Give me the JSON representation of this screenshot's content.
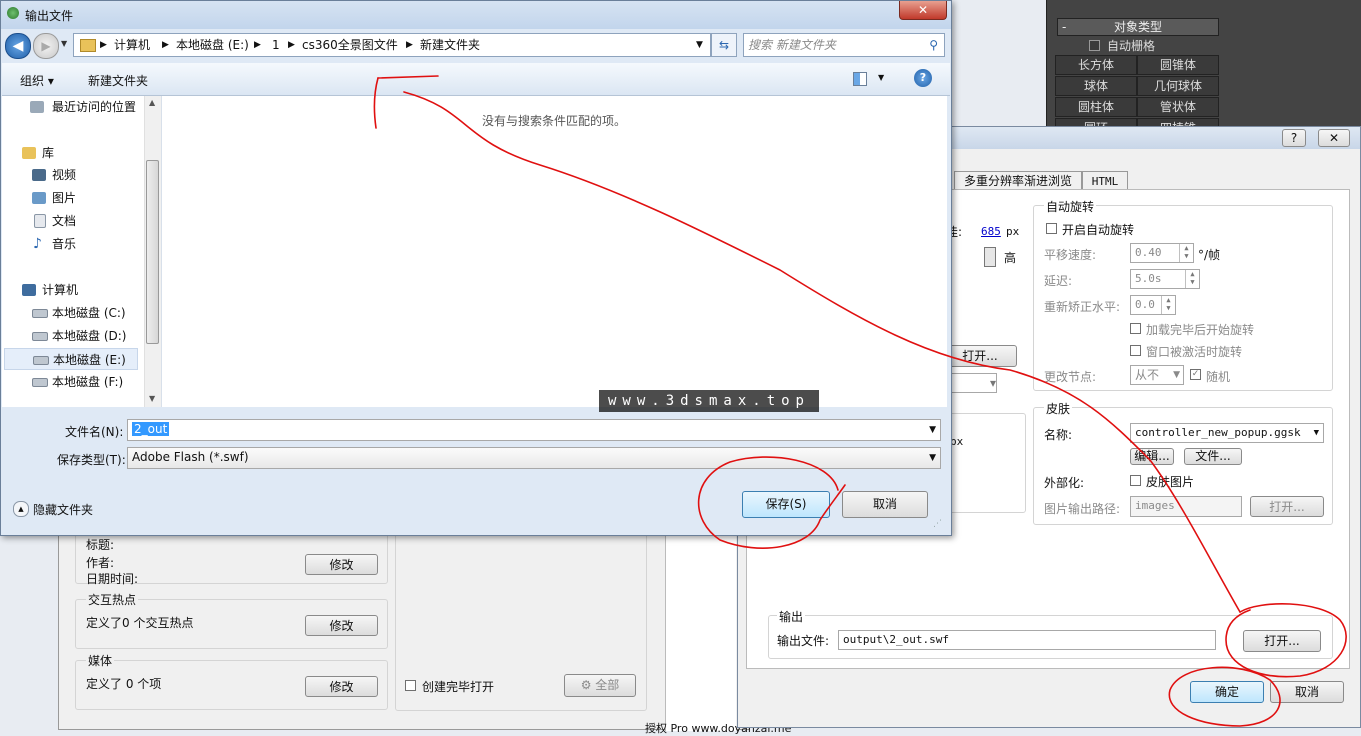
{
  "max_panel": {
    "section_title": "对象类型",
    "autogrid_label": "自动栅格",
    "objects": [
      "长方体",
      "圆锥体",
      "球体",
      "几何球体",
      "圆柱体",
      "管状体",
      "圆环",
      "四棱锥"
    ]
  },
  "export_dialog": {
    "title_q": "?",
    "tabs": [
      "多重分辨率渐进浏览",
      "HTML"
    ],
    "partial_label": "佳:",
    "partial_value": "685",
    "partial_unit": "px",
    "high_label": "高",
    "open_partial": "打开...",
    "partial_px": "px",
    "autorotate": {
      "group_title": "自动旋转",
      "enable_label": "开启自动旋转",
      "pan_speed_label": "平移速度:",
      "pan_speed_value": "0.40",
      "pan_speed_unit": "°/帧",
      "delay_label": "延迟:",
      "delay_value": "5.0s",
      "level_label": "重新矫正水平:",
      "level_value": "0.0",
      "after_load_label": "加载完毕后开始旋转",
      "on_activate_label": "窗口被激活时旋转",
      "change_node_label": "更改节点:",
      "change_node_value": "从不",
      "random_label": "随机"
    },
    "skin": {
      "group_title": "皮肤",
      "name_label": "名称:",
      "name_value": "controller_new_popup.ggsk",
      "edit_button": "编辑...",
      "file_button": "文件...",
      "externalize_label": "外部化:",
      "skin_images_label": "皮肤图片",
      "image_path_label": "图片输出路径:",
      "image_path_value": "images",
      "open_button": "打开..."
    },
    "output": {
      "group_title": "输出",
      "file_label": "输出文件:",
      "file_value": "output\\2_out.swf",
      "open_button": "打开...",
      "ok_button": "确定",
      "cancel_button": "取消"
    }
  },
  "bottom_panel": {
    "title_partial": "标题:",
    "author_label": "作者:",
    "datetime_label": "日期时间:",
    "modify1": "修改",
    "hotspots_title": "交互热点",
    "hotspots_text": "定义了0 个交互热点",
    "modify2": "修改",
    "media_title": "媒体",
    "media_text": "定义了 0 个项",
    "modify3": "修改",
    "open_when_done": "创建完毕打开",
    "all_button": "全部",
    "license_text": "授权 Pro  www.doyanzai.me"
  },
  "save_dialog": {
    "title": "输出文件",
    "close": "✕",
    "breadcrumb": [
      "计算机",
      "本地磁盘 (E:)",
      "1",
      "cs360全景图文件",
      "新建文件夹"
    ],
    "search_placeholder": "搜索 新建文件夹",
    "toolbar_organize": "组织 ▾",
    "toolbar_new_folder": "新建文件夹",
    "help": "?",
    "nav": {
      "recent": "最近访问的位置",
      "libraries": "库",
      "videos": "视频",
      "pictures": "图片",
      "documents": "文档",
      "music": "音乐",
      "computer": "计算机",
      "drive_c": "本地磁盘 (C:)",
      "drive_d": "本地磁盘 (D:)",
      "drive_e": "本地磁盘 (E:)",
      "drive_f": "本地磁盘 (F:)"
    },
    "empty_message": "没有与搜索条件匹配的项。",
    "watermark": "www.3dsmax.top",
    "filename_label": "文件名(N):",
    "filename_value": "2_out",
    "filetype_label": "保存类型(T):",
    "filetype_value": "Adobe Flash (*.swf)",
    "hide_folders": "隐藏文件夹",
    "save_button": "保存(S)",
    "cancel_button": "取消"
  },
  "colors": {
    "annotation_red": "#e01010",
    "selection_blue": "#3399ff",
    "link_blue": "#0000cc"
  }
}
